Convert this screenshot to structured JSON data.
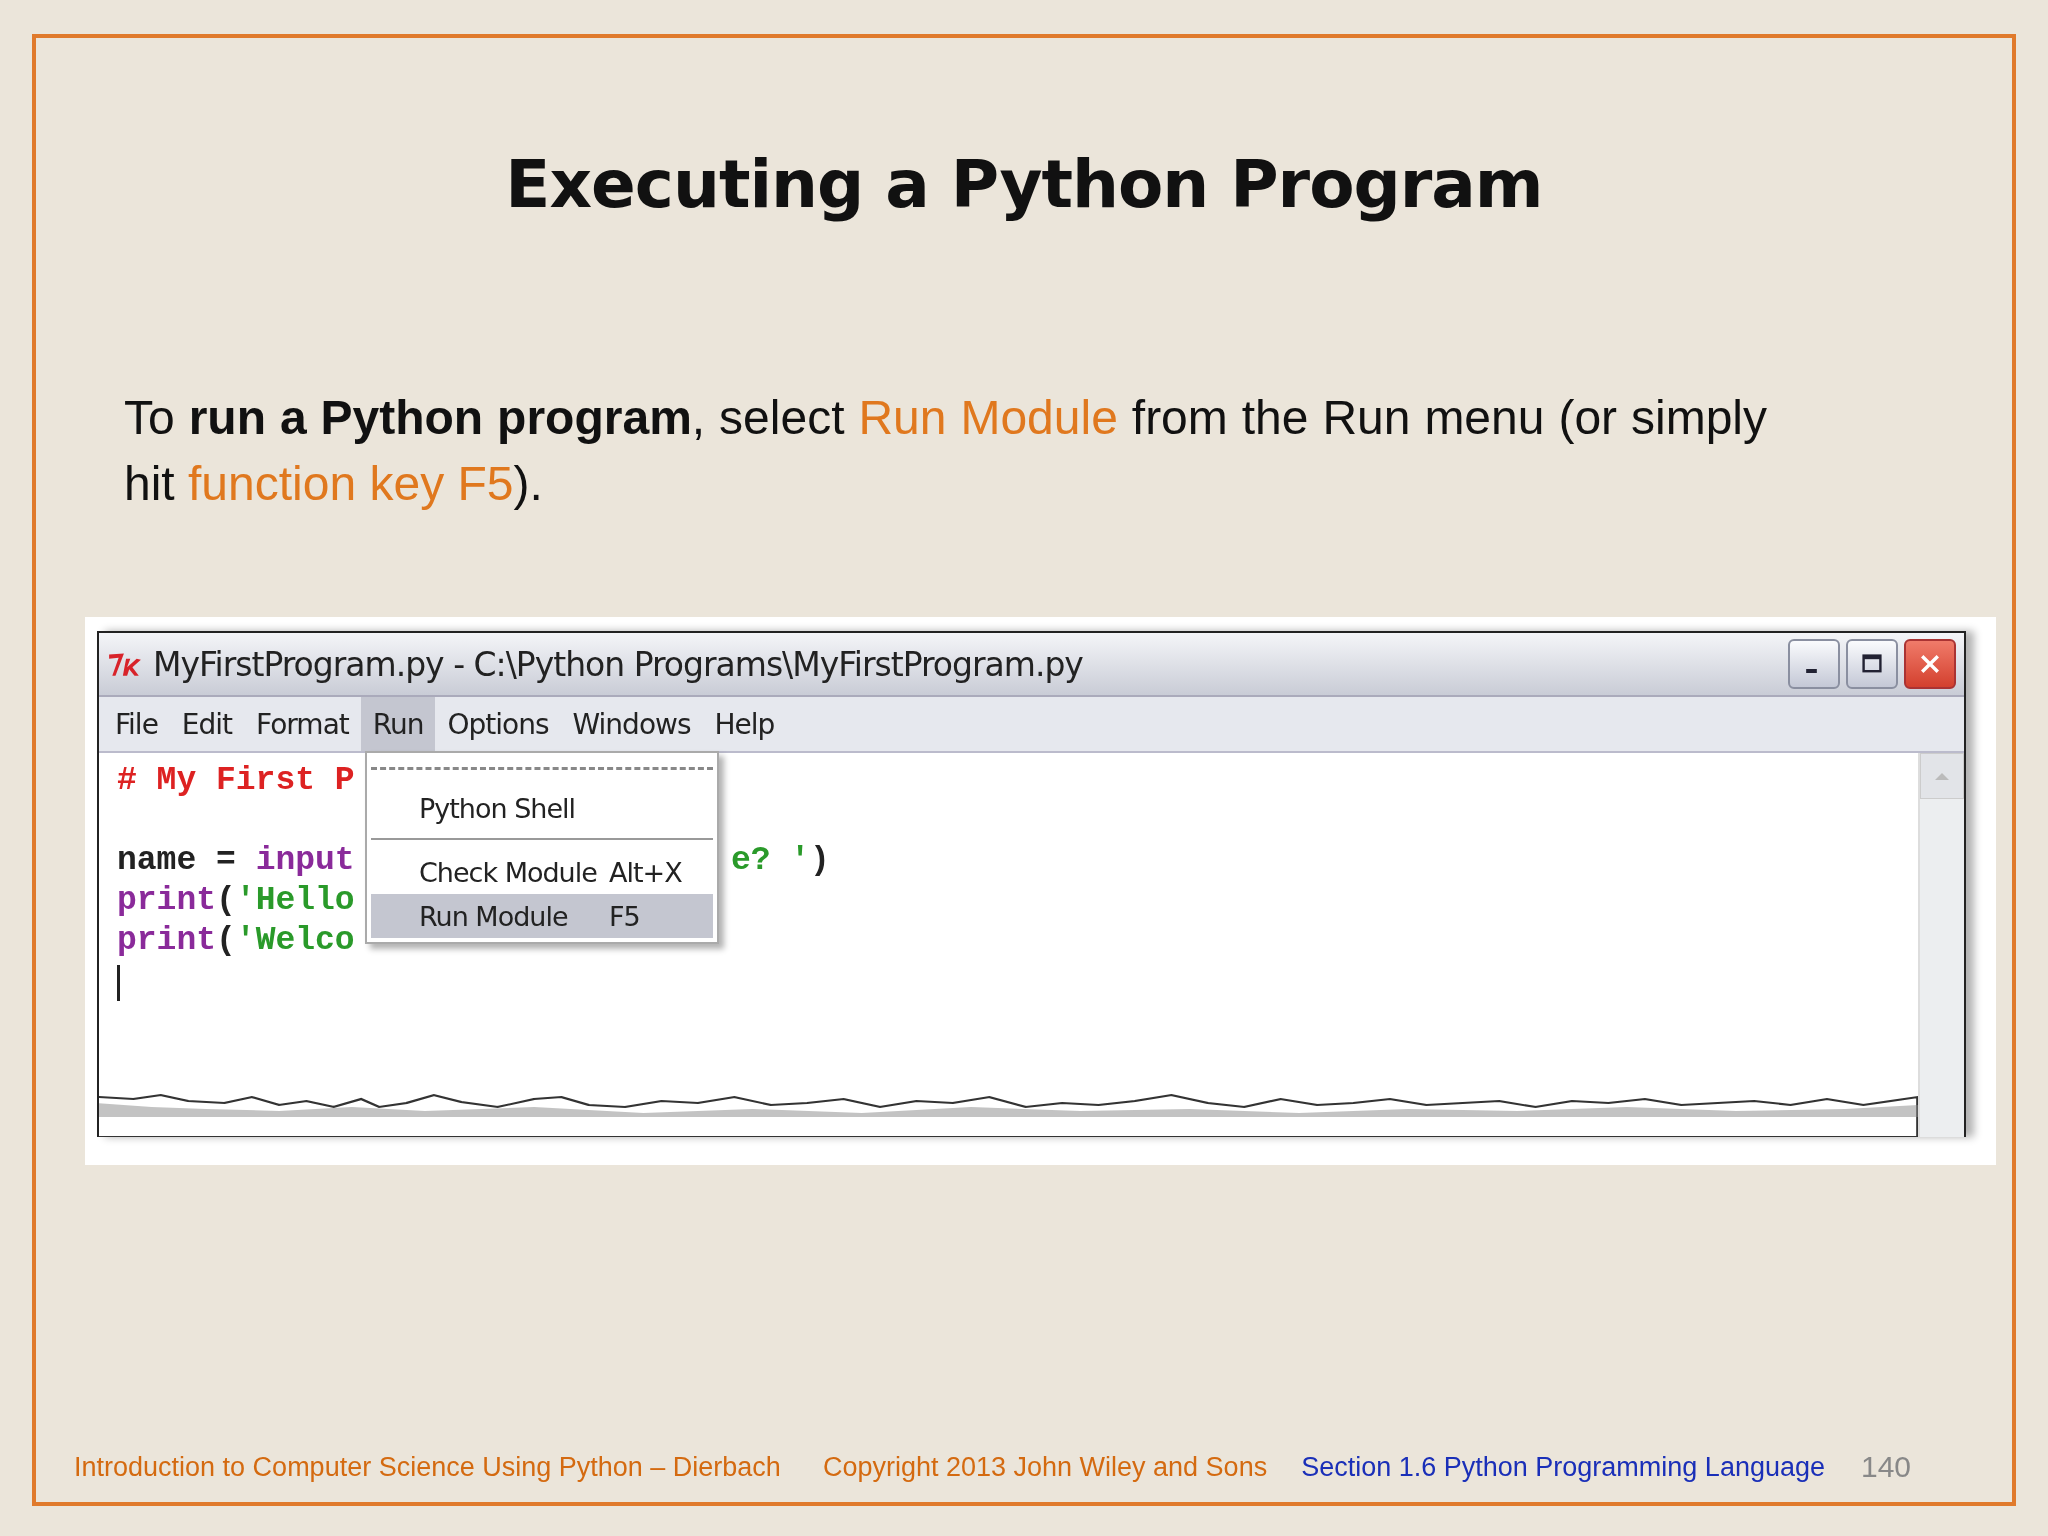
{
  "title": "Executing a Python Program",
  "paragraph": [
    {
      "kind": "plain",
      "text": "To "
    },
    {
      "kind": "bold",
      "text": "run a Python program"
    },
    {
      "kind": "plain",
      "text": ", select "
    },
    {
      "kind": "highlight",
      "text": "Run Module"
    },
    {
      "kind": "plain",
      "text": " from the Run menu (or simply hit "
    },
    {
      "kind": "highlight",
      "text": "function key F5"
    },
    {
      "kind": "plain",
      "text": ")."
    }
  ],
  "window": {
    "title": "MyFirstProgram.py - C:\\Python Programs\\MyFirstProgram.py",
    "menu": [
      {
        "label": "File",
        "selected": false
      },
      {
        "label": "Edit",
        "selected": false
      },
      {
        "label": "Format",
        "selected": false
      },
      {
        "label": "Run",
        "selected": true
      },
      {
        "label": "Options",
        "selected": false
      },
      {
        "label": "Windows",
        "selected": false
      },
      {
        "label": "Help",
        "selected": false
      }
    ],
    "code": [
      {
        "left": [
          {
            "kind": "comment",
            "text": "# My First P"
          }
        ]
      },
      {
        "kind": "blank"
      },
      {
        "left": [
          {
            "kind": "plain",
            "text": "name = "
          },
          {
            "kind": "builtin",
            "text": "input"
          }
        ],
        "right": [
          {
            "kind": "string",
            "text": "e? '"
          },
          {
            "kind": "plain",
            "text": ")"
          }
        ]
      },
      {
        "left": [
          {
            "kind": "builtin",
            "text": "print"
          },
          {
            "kind": "plain",
            "text": "("
          },
          {
            "kind": "string",
            "text": "'Hello"
          }
        ]
      },
      {
        "left": [
          {
            "kind": "builtin",
            "text": "print"
          },
          {
            "kind": "plain",
            "text": "("
          },
          {
            "kind": "string",
            "text": "'Welco"
          }
        ]
      }
    ],
    "dropdown": [
      {
        "kind": "tearoff"
      },
      {
        "kind": "item",
        "label": "Python Shell",
        "selected": false
      },
      {
        "kind": "separator"
      },
      {
        "kind": "item",
        "label": "Check Module",
        "shortcut": "Alt+X",
        "selected": false
      },
      {
        "kind": "item",
        "label": "Run Module",
        "shortcut": "F5",
        "selected": true
      }
    ]
  },
  "footer": {
    "book": "Introduction to Computer Science Using Python – Dierbach",
    "copyright": "Copyright 2013 John Wiley and  Sons",
    "section": "Section 1.6  Python Programming Language",
    "page": "140"
  }
}
